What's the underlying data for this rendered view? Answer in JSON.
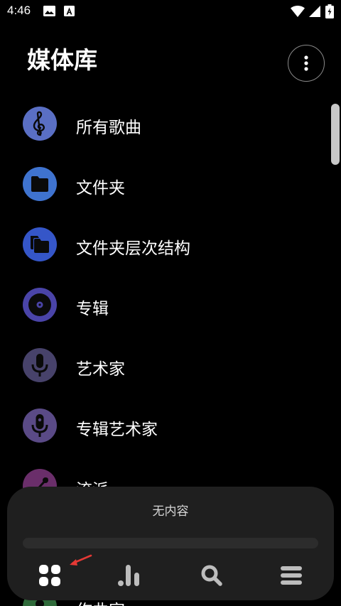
{
  "status_bar": {
    "time": "4:46"
  },
  "header": {
    "title": "媒体库"
  },
  "library_items": [
    {
      "label": "所有歌曲",
      "icon": "treble-clef-icon",
      "color": "#5a6fc4"
    },
    {
      "label": "文件夹",
      "icon": "folder-icon",
      "color": "#3f73cf"
    },
    {
      "label": "文件夹层次结构",
      "icon": "folder-tree-icon",
      "color": "#3556c8"
    },
    {
      "label": "专辑",
      "icon": "album-disc-icon",
      "color": "#4a44a8"
    },
    {
      "label": "艺术家",
      "icon": "microphone-icon",
      "color": "#47426a"
    },
    {
      "label": "专辑艺术家",
      "icon": "album-artist-microphone-icon",
      "color": "#5a4a86"
    },
    {
      "label": "流派",
      "icon": "guitar-icon",
      "color": "#6a2e6a"
    },
    {
      "label": "作曲家",
      "icon": "composer-icon",
      "color": "#2f6a3a"
    }
  ],
  "player": {
    "now_playing": "无内容"
  },
  "bottom_nav": [
    {
      "name": "library",
      "icon": "grid-icon"
    },
    {
      "name": "charts",
      "icon": "bar-chart-icon"
    },
    {
      "name": "search",
      "icon": "search-icon"
    },
    {
      "name": "queue",
      "icon": "menu-icon"
    }
  ],
  "colors": {
    "background": "#000000",
    "panel": "#1f1f1f",
    "hint_arrow": "#e53935"
  }
}
